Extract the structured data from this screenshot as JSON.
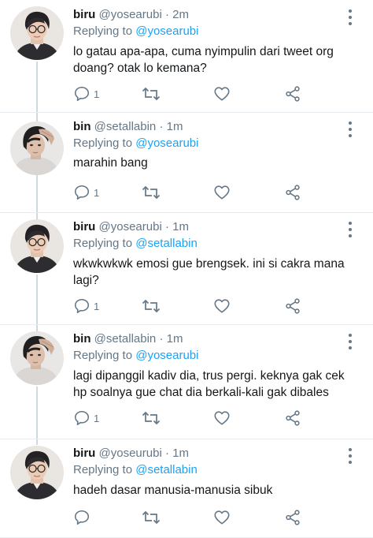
{
  "tweets": [
    {
      "name": "biru",
      "handle": "@yosearubi",
      "separator": "·",
      "time": "2m",
      "replying_prefix": "Replying to",
      "replying_to": "@yosearubi",
      "text": "lo gatau apa-apa, cuma nyimpulin dari tweet org doang? otak lo kemana?",
      "reply_count": "1",
      "avatar": "avatar-glasses"
    },
    {
      "name": "bin",
      "handle": "@setallabin",
      "separator": "·",
      "time": "1m",
      "replying_prefix": "Replying to",
      "replying_to": "@yosearubi",
      "text": "marahin bang",
      "reply_count": "1",
      "avatar": "avatar-hand-on-head"
    },
    {
      "name": "biru",
      "handle": "@yosearubi",
      "separator": "·",
      "time": "1m",
      "replying_prefix": "Replying to",
      "replying_to": "@setallabin",
      "text": "wkwkwkwk emosi gue brengsek. ini si cakra mana lagi?",
      "reply_count": "1",
      "avatar": "avatar-glasses"
    },
    {
      "name": "bin",
      "handle": "@setallabin",
      "separator": "·",
      "time": "1m",
      "replying_prefix": "Replying to",
      "replying_to": "@yosearubi",
      "text": "lagi dipanggil kadiv dia, trus pergi. keknya gak cek hp soalnya gue chat dia berkali-kali gak dibales",
      "reply_count": "1",
      "avatar": "avatar-hand-on-head"
    },
    {
      "name": "biru",
      "handle": "@yoseurubi",
      "separator": "·",
      "time": "1m",
      "replying_prefix": "Replying to",
      "replying_to": "@setallabin",
      "text": "hadeh dasar manusia-manusia sibuk",
      "reply_count": "",
      "avatar": "avatar-glasses"
    }
  ],
  "icons": {
    "reply": "reply-icon",
    "retweet": "retweet-icon",
    "like": "heart-icon",
    "share": "share-icon",
    "more": "more-vertical-icon"
  },
  "colors": {
    "link": "#1da1f2",
    "secondary": "#657786",
    "text": "#14171a"
  }
}
